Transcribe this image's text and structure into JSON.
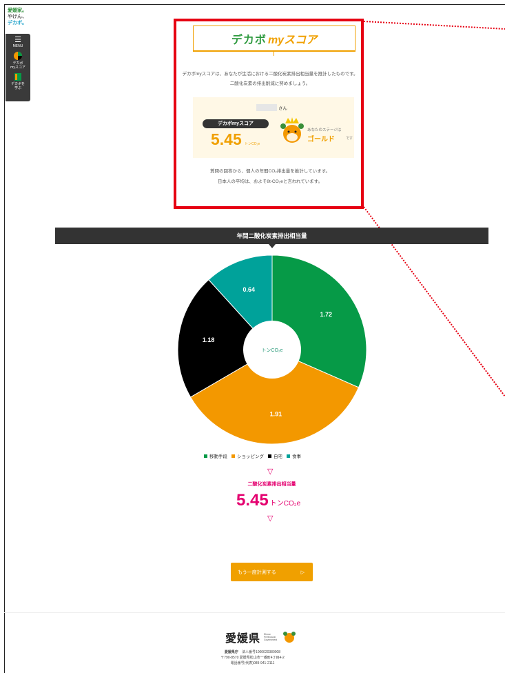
{
  "brand": {
    "line1": "愛媛家。",
    "line2": "やけん、",
    "line3": "デカボ。"
  },
  "sidenav": {
    "menu_label": "MENU",
    "items": [
      {
        "label": "デカボ\nmyスコア"
      },
      {
        "label": "デカボを\n学ぶ"
      }
    ]
  },
  "hero": {
    "banner_part1": "デカボ",
    "banner_part2": "myスコア",
    "desc_line1": "デカボmyスコアは、あなたが生活における二酸化炭素排出相当量を推計したものです。",
    "desc_line2": "二酸化炭素の排出削減に努めましょう。",
    "name_suffix": "さん",
    "score_pill": "デカボmyスコア",
    "score_value": "5.45",
    "score_unit": "トンCO₂e",
    "stage_label": "あなたのステージは",
    "stage_value": "ゴールド",
    "stage_suffix": "です",
    "note_line1": "質問の回答から、個人の年間CO₂排出量を推計しています。",
    "note_line2": "日本人の平均は、およそ8t-CO₂eと言われています。"
  },
  "section_title": "年間二酸化炭素排出相当量",
  "chart_data": {
    "type": "pie",
    "center_label": "トンCO₂e",
    "categories": [
      "移動手段",
      "ショッピング",
      "自宅",
      "食事"
    ],
    "values": [
      1.72,
      1.91,
      1.18,
      0.64
    ],
    "colors": [
      "#069a47",
      "#f39800",
      "#000000",
      "#00a29a"
    ]
  },
  "total": {
    "label": "二酸化炭素排出相当量",
    "value": "5.45",
    "unit": "トンCO₂e"
  },
  "retry_button": {
    "label": "もう一度計測する",
    "arrow": "▷"
  },
  "footer": {
    "pref": "愛媛県",
    "badge": "Ehime Prefectural Government",
    "office": "愛媛県庁",
    "corp_no": "法人番号1000020380008",
    "address": "〒790-8570 愛媛県松山市一番町4丁目4-2",
    "phone": "電話番号(代表)089-941-2111"
  }
}
